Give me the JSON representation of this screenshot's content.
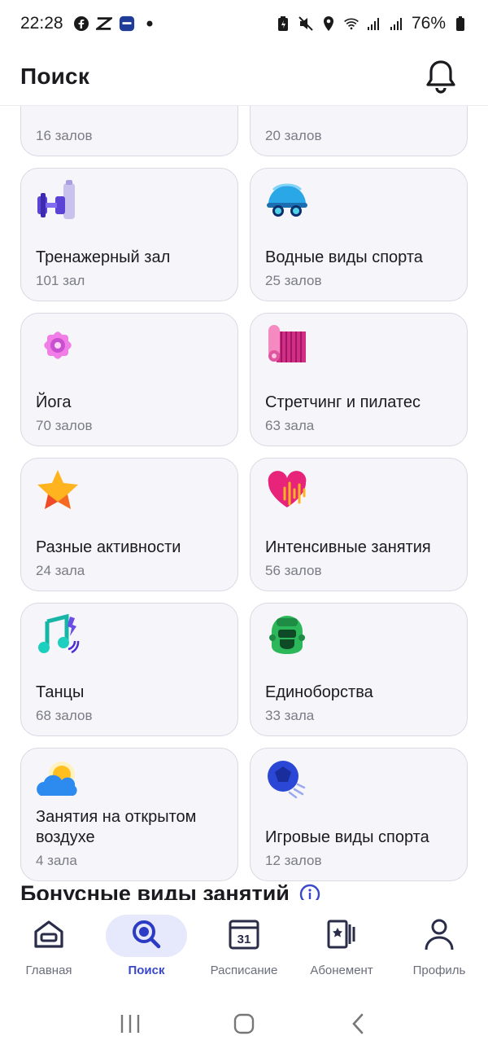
{
  "status_bar": {
    "time": "22:28",
    "battery": "76%"
  },
  "header": {
    "title": "Поиск"
  },
  "categories": [
    {
      "title": "",
      "count": "16 залов",
      "icon": "partial-card-icon"
    },
    {
      "title": "",
      "count": "20 залов",
      "icon": "partial-card-icon"
    },
    {
      "title": "Тренажерный зал",
      "count": "101 зал",
      "icon": "dumbbell-icon"
    },
    {
      "title": "Водные виды спорта",
      "count": "25 залов",
      "icon": "swim-cap-icon"
    },
    {
      "title": "Йога",
      "count": "70 залов",
      "icon": "lotus-icon"
    },
    {
      "title": "Стретчинг и пилатес",
      "count": "63 зала",
      "icon": "yoga-mat-icon"
    },
    {
      "title": "Разные активности",
      "count": "24 зала",
      "icon": "star-icon"
    },
    {
      "title": "Интенсивные занятия",
      "count": "56 залов",
      "icon": "heart-pulse-icon"
    },
    {
      "title": "Танцы",
      "count": "68 залов",
      "icon": "music-note-icon"
    },
    {
      "title": "Единоборства",
      "count": "33 зала",
      "icon": "boxing-helmet-icon"
    },
    {
      "title": "Занятия на открытом воздухе",
      "count": "4 зала",
      "icon": "sun-cloud-icon"
    },
    {
      "title": "Игровые виды спорта",
      "count": "12 залов",
      "icon": "ball-icon"
    }
  ],
  "bonus": {
    "title": "Бонусные виды занятий"
  },
  "bottom_nav": [
    {
      "label": "Главная",
      "icon": "home-icon",
      "active": false
    },
    {
      "label": "Поиск",
      "icon": "search-icon",
      "active": true
    },
    {
      "label": "Расписание",
      "icon": "calendar-icon",
      "active": false,
      "badge": "31"
    },
    {
      "label": "Абонемент",
      "icon": "membership-card-icon",
      "active": false
    },
    {
      "label": "Профиль",
      "icon": "profile-icon",
      "active": false
    }
  ],
  "colors": {
    "accent": "#3a48c9",
    "nav_active_bg": "#e6e8fb",
    "card_bg": "#f5f5fa",
    "text_secondary": "#7b7b85"
  }
}
